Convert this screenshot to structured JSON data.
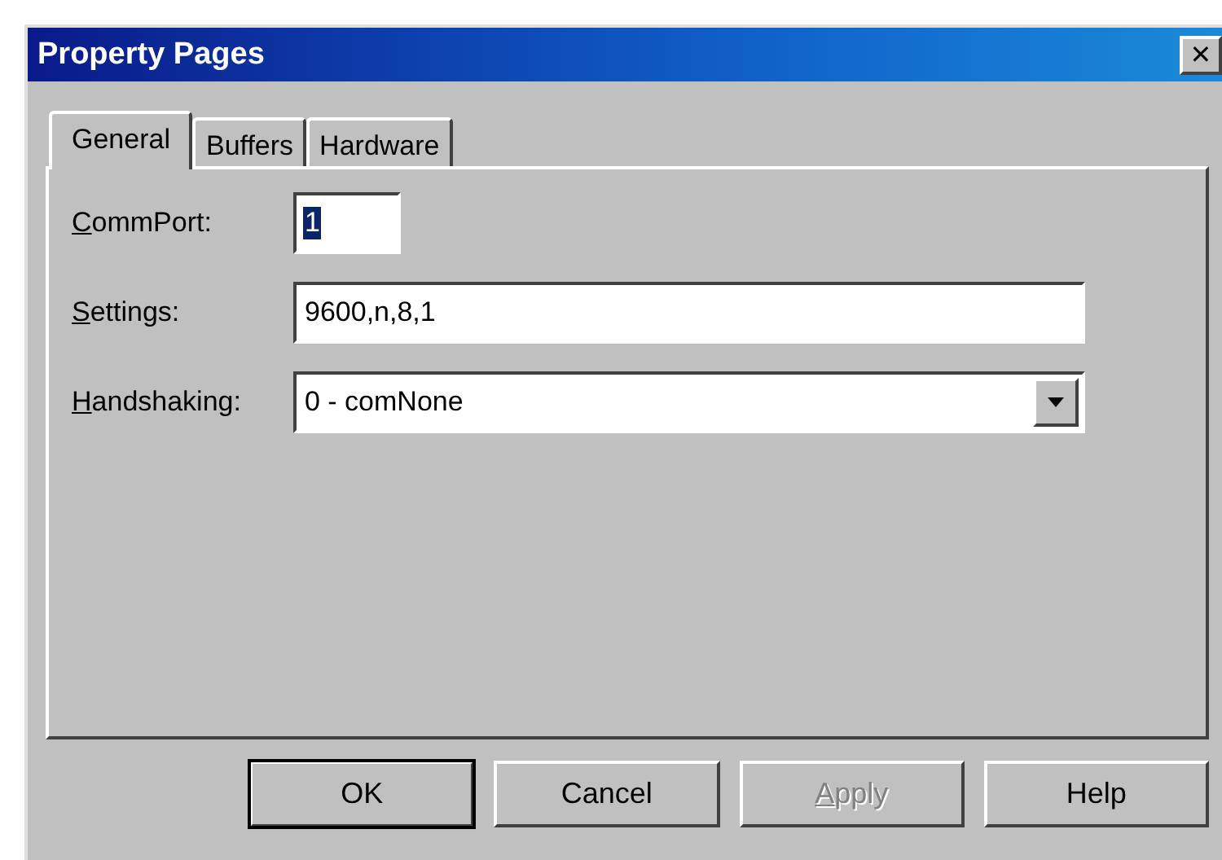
{
  "window": {
    "title": "Property Pages",
    "close_button": "✕"
  },
  "tabs": [
    {
      "label": "General",
      "selected": true
    },
    {
      "label": "Buffers",
      "selected": false
    },
    {
      "label": "Hardware",
      "selected": false
    }
  ],
  "fields": [
    {
      "kind": "short_text",
      "label": "CommPort:",
      "access_key": true,
      "value": "1",
      "text_selected": true
    },
    {
      "kind": "text",
      "label": "Settings:",
      "access_key": true,
      "value": "9600,n,8,1",
      "text_selected": false
    },
    {
      "kind": "dropdown",
      "label": "Handshaking:",
      "access_key": true,
      "value": "0 - comNone",
      "text_selected": false
    }
  ],
  "buttons": [
    {
      "label": "OK",
      "default": true,
      "disabled": false,
      "access_key": false
    },
    {
      "label": "Cancel",
      "default": false,
      "disabled": false,
      "access_key": false
    },
    {
      "label": "Apply",
      "default": false,
      "disabled": true,
      "access_key": true
    },
    {
      "label": "Help",
      "default": false,
      "disabled": false,
      "access_key": false
    }
  ]
}
